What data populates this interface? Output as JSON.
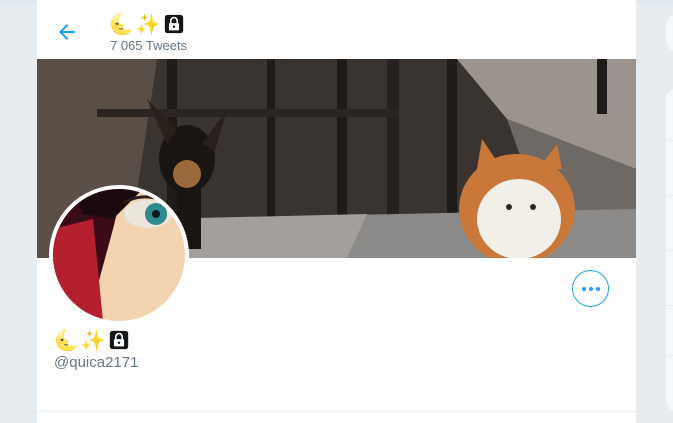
{
  "header": {
    "back_label": "←",
    "name_parts": [
      "🌜",
      "✨"
    ],
    "tweet_count": "7 065 Tweets"
  },
  "profile": {
    "name_parts": [
      "🌜",
      "✨"
    ],
    "handle": "@quica2171",
    "more_label": "More"
  },
  "colors": {
    "accent": "#1da1f2",
    "secondary_text": "#657786",
    "border": "#e6ecf0"
  },
  "icons": {
    "back": "arrow-left-icon",
    "lock": "lock-icon",
    "more": "more-horizontal-icon"
  }
}
